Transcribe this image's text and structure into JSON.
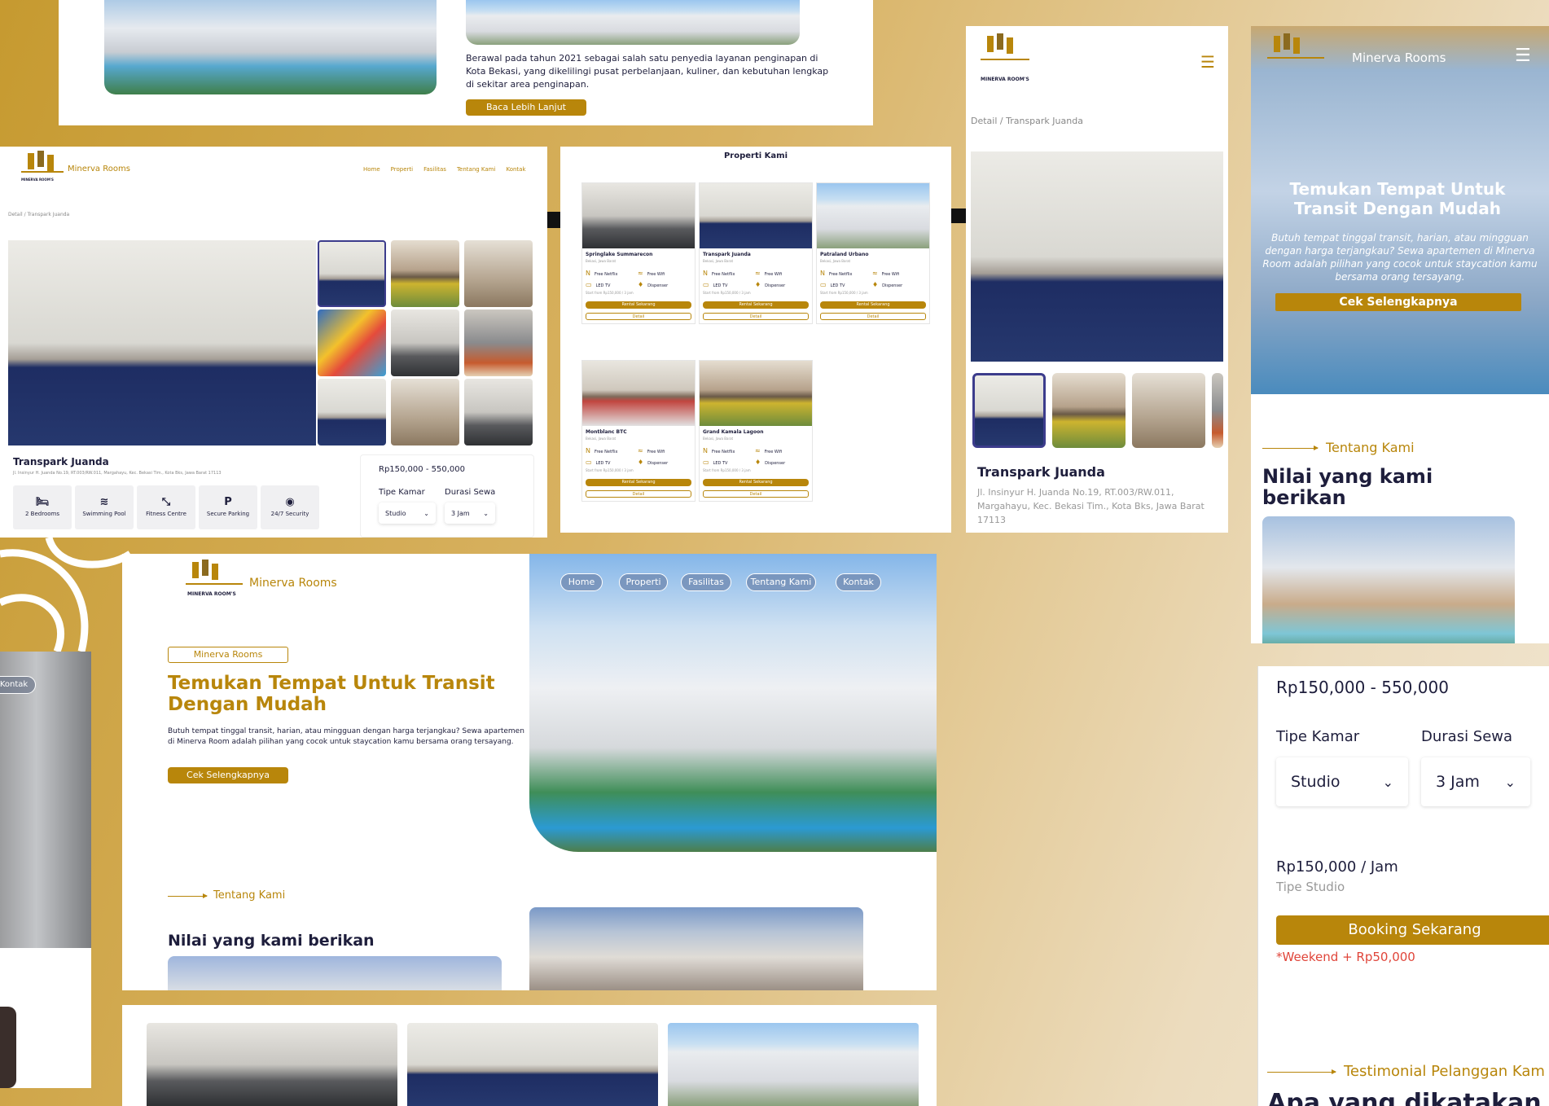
{
  "panelA": {
    "about_text": "Berawal pada tahun 2021 sebagai salah satu penyedia layanan penginapan di Kota Bekasi, yang dikelilingi pusat perbelanjaan, kuliner, dan kebutuhan lengkap di sekitar area penginapan.",
    "read_more": "Baca Lebih Lanjut"
  },
  "panelB": {
    "brand": "Minerva Rooms",
    "logo_text": "MINERVA ROOM'S",
    "nav": [
      "Home",
      "Properti",
      "Fasilitas",
      "Tentang Kami",
      "Kontak"
    ],
    "breadcrumb": "Detail / Transpark Juanda",
    "title": "Transpark Juanda",
    "address": "Jl. Insinyur H. Juanda No.19, RT.003/RW.011, Margahayu, Kec. Bekasi Tim., Kota Bks, Jawa Barat 17113",
    "amenities": [
      {
        "icon": "bed-icon",
        "glyph": "🛏",
        "label": "2 Bedrooms"
      },
      {
        "icon": "swimming-pool-icon",
        "glyph": "≋",
        "label": "Swimming Pool"
      },
      {
        "icon": "fitness-icon",
        "glyph": "⤡",
        "label": "Fitness Centre"
      },
      {
        "icon": "parking-icon",
        "glyph": "P",
        "label": "Secure Parking"
      },
      {
        "icon": "security-camera-icon",
        "glyph": "◉",
        "label": "24/7 Security"
      }
    ],
    "price_range": "Rp150,000 - 550,000",
    "room_type_label": "Tipe Kamar",
    "duration_label": "Durasi Sewa",
    "room_type_value": "Studio",
    "duration_value": "3 Jam"
  },
  "panelC": {
    "heading": "Properti Kami",
    "cards": [
      {
        "name": "Springlake Summarecon",
        "location": "Bekasi, Jawa Barat"
      },
      {
        "name": "Transpark Juanda",
        "location": "Bekasi, Jawa Barat"
      },
      {
        "name": "Patraland Urbano",
        "location": "Bekasi, Jawa Barat"
      },
      {
        "name": "Montblanc BTC",
        "location": "Bekasi, Jawa Barat"
      },
      {
        "name": "Grand Kamala Lagoon",
        "location": "Bekasi, Jawa Barat"
      }
    ],
    "features": [
      "Free Netflix",
      "Free Wifi",
      "LED TV",
      "Dispenser"
    ],
    "price_text": "Start from Rp150,000 / 3 jam",
    "rent_label": "Rental Sekarang",
    "detail_label": "Detail"
  },
  "panelD": {
    "logo_text": "MINERVA ROOM'S",
    "breadcrumb": "Detail / Transpark Juanda",
    "title": "Transpark Juanda",
    "address": "Jl. Insinyur H. Juanda No.19, RT.003/RW.011, Margahayu, Kec. Bekasi Tim., Kota Bks, Jawa Barat 17113"
  },
  "panelE": {
    "brand": "Minerva Rooms",
    "hero_title": "Temukan Tempat Untuk Transit Dengan Mudah",
    "hero_text": "Butuh tempat tinggal transit, harian, atau mingguan dengan harga terjangkau? Sewa apartemen di Minerva Room adalah pilihan yang cocok untuk staycation kamu bersama orang tersayang.",
    "cta": "Cek Selengkapnya",
    "about_label": "Tentang Kami",
    "about_heading": "Nilai yang kami berikan"
  },
  "panelF": {
    "brand": "Minerva Rooms",
    "logo_text": "MINERVA ROOM'S",
    "nav": [
      "Home",
      "Properti",
      "Fasilitas",
      "Tentang Kami",
      "Kontak"
    ],
    "badge": "Minerva Rooms",
    "hero_title": "Temukan Tempat Untuk Transit Dengan Mudah",
    "hero_text": "Butuh tempat tinggal transit, harian, atau mingguan dengan harga terjangkau? Sewa apartemen di Minerva Room adalah pilihan yang cocok untuk staycation kamu bersama orang tersayang.",
    "cta": "Cek Selengkapnya",
    "about_label": "Tentang Kami",
    "about_heading": "Nilai yang kami berikan"
  },
  "panelG": {
    "price_range": "Rp150,000 - 550,000",
    "room_type_label": "Tipe Kamar",
    "duration_label": "Durasi Sewa",
    "room_type_value": "Studio",
    "duration_value": "3 Jam",
    "price_per": "Rp150,000 / Jam",
    "type_note": "Tipe Studio",
    "booking": "Booking Sekarang",
    "weekend_note": "*Weekend + Rp50,000",
    "testimonial_label": "Testimonial Pelanggan Kam",
    "testimonial_heading": "Apa yang dikatakan"
  },
  "panelH": {
    "nav_partial": "Kontak"
  },
  "colors": {
    "accent": "#b8860b",
    "navy": "#1e1e3c",
    "weekend": "#e0453a"
  }
}
